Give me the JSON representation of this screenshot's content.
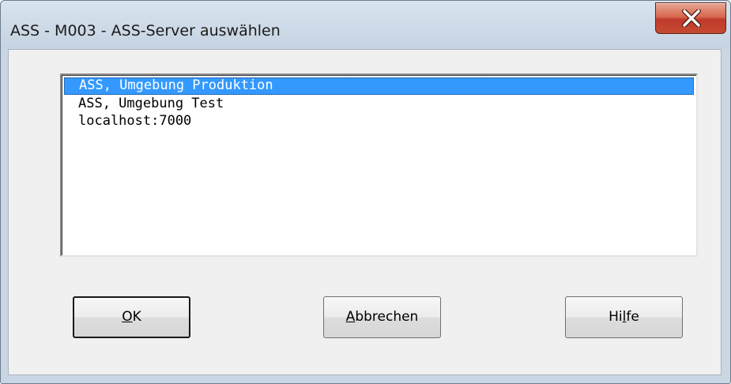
{
  "window": {
    "title": "ASS - M003 - ASS-Server auswählen",
    "close_icon": "close-x-icon"
  },
  "server_list": {
    "items": [
      {
        "label": "ASS, Umgebung Produktion",
        "selected": true
      },
      {
        "label": "ASS, Umgebung Test",
        "selected": false
      },
      {
        "label": "localhost:7000",
        "selected": false
      }
    ],
    "selection_color": "#3399ff"
  },
  "buttons": {
    "ok": {
      "mnemonic": "O",
      "rest": "K"
    },
    "cancel": {
      "mnemonic": "A",
      "rest": "bbrechen"
    },
    "help": {
      "before": "Hi",
      "mnemonic": "l",
      "rest": "fe"
    }
  }
}
